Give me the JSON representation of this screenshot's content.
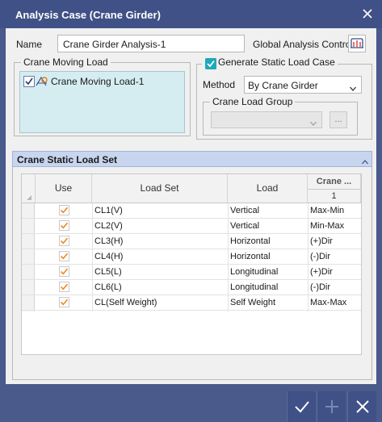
{
  "window": {
    "title": "Analysis Case (Crane Girder)"
  },
  "name_row": {
    "label": "Name",
    "value": "Crane Girder Analysis-1",
    "global_control_label": "Global Analysis Control"
  },
  "crane_moving_load": {
    "legend": "Crane Moving Load",
    "items": [
      {
        "label": "Crane Moving Load-1",
        "checked": true
      }
    ]
  },
  "static_load_case": {
    "checkbox_label": "Generate Static Load Case",
    "checked": true,
    "method_label": "Method",
    "method_value": "By Crane Girder",
    "group_legend": "Crane Load Group",
    "group_value": "",
    "ellipsis": "..."
  },
  "section": {
    "title": "Crane Static Load Set"
  },
  "grid": {
    "headers": {
      "use": "Use",
      "load_set": "Load Set",
      "load": "Load",
      "crane": "Crane ...",
      "crane_sub": "1"
    },
    "rows": [
      {
        "use": true,
        "load_set": "CL1(V)",
        "load": "Vertical",
        "crane": "Max-Min"
      },
      {
        "use": true,
        "load_set": "CL2(V)",
        "load": "Vertical",
        "crane": "Min-Max"
      },
      {
        "use": true,
        "load_set": "CL3(H)",
        "load": "Horizontal",
        "crane": "(+)Dir"
      },
      {
        "use": true,
        "load_set": "CL4(H)",
        "load": "Horizontal",
        "crane": "(-)Dir"
      },
      {
        "use": true,
        "load_set": "CL5(L)",
        "load": "Longitudinal",
        "crane": "(+)Dir"
      },
      {
        "use": true,
        "load_set": "CL6(L)",
        "load": "Longitudinal",
        "crane": "(-)Dir"
      },
      {
        "use": true,
        "load_set": "CL(Self Weight)",
        "load": "Self Weight",
        "crane": "Max-Max"
      }
    ]
  },
  "colors": {
    "accent": "#3f5186",
    "check_orange": "#f08a24",
    "check_teal": "#1fa8b8"
  }
}
